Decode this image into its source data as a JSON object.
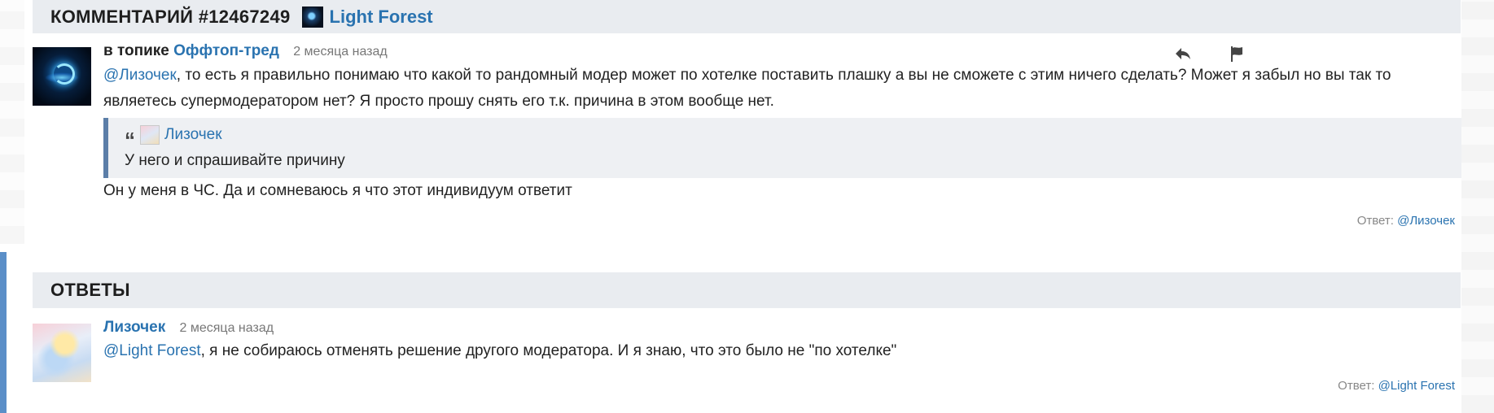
{
  "comment": {
    "heading": "КОММЕНТАРИЙ #12467249",
    "author": "Light Forest",
    "in_topic_label": "в топике",
    "topic": "Оффтоп-тред",
    "time": "2 месяца назад",
    "mention": "@Лизочек",
    "text_line1": ", то есть я правильно понимаю что какой то рандомный модер может по хотелке поставить плашку а вы не сможете с этим ничего сделать? Может я забыл но вы так то",
    "text_line2": "являетесь супермодератором нет? Я просто прошу снять его т.к. причина в этом вообще нет.",
    "quote_author": "Лизочек",
    "quote_text": "У него и спрашивайте причину",
    "text_after_quote": "Он у меня в ЧС. Да и сомневаюсь я что этот индивидуум ответит",
    "reply_label": "Ответ:",
    "reply_target": "@Лизочек"
  },
  "answers": {
    "heading": "ОТВЕТЫ",
    "items": [
      {
        "author": "Лизочек",
        "time": "2 месяца назад",
        "mention": "@Light Forest",
        "text": ", я не собираюсь отменять решение другого модератора. И я знаю, что это было не \"по хотелке\"",
        "reply_label": "Ответ:",
        "reply_target": "@Light Forest"
      }
    ]
  },
  "icons": {
    "reply": "reply-arrow-icon",
    "report": "flag-icon",
    "quote": "quote-marks-icon"
  },
  "colors": {
    "link": "#2a73b0",
    "header_bg": "#e9ecf0",
    "quote_border": "#5b7ea8"
  }
}
